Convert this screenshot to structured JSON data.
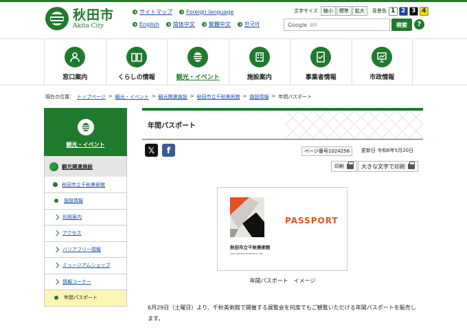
{
  "header": {
    "logo_ja": "秋田市",
    "logo_en": "Akita City",
    "links_row1": [
      "サイトマップ",
      "Foreign language"
    ],
    "links_row2": [
      "English",
      "简体中文",
      "繁體中文",
      "한국어"
    ],
    "text_size_label": "文字サイズ",
    "text_size_buttons": [
      "縮小",
      "標準",
      "拡大"
    ],
    "bg_label": "背景色",
    "bg_buttons": [
      "1",
      "2",
      "3",
      "4"
    ],
    "bg_colors": [
      "#ffffff",
      "#1e3fb0",
      "#000000",
      "#f5d400"
    ],
    "search_brand": "Google",
    "search_ad": "提供",
    "search_button": "検索",
    "help_label": "?"
  },
  "gnav": [
    {
      "label": "窓口案内",
      "icon": "person-icon"
    },
    {
      "label": "くらしの情報",
      "icon": "book-icon"
    },
    {
      "label": "観光・イベント",
      "icon": "lantern-icon",
      "active": true
    },
    {
      "label": "施設案内",
      "icon": "building-icon"
    },
    {
      "label": "事業者情報",
      "icon": "document-check-icon"
    },
    {
      "label": "市政情報",
      "icon": "presentation-icon"
    }
  ],
  "breadcrumb": {
    "prefix": "現在の位置：",
    "items": [
      "トップページ",
      "観光・イベント",
      "観光関連施設",
      "秋田市立千秋美術館",
      "施設情報",
      "年間パスポート"
    ]
  },
  "sidebar": {
    "head": "観光・イベント",
    "level1": "観光関連施設",
    "level2": "秋田市立千秋美術館",
    "items": [
      "施設情報",
      "利用案内",
      "アクセス",
      "バリアフリー情報",
      "ミュージアムショップ",
      "情報コーナー",
      "年間パスポート"
    ]
  },
  "main": {
    "title": "年間パスポート",
    "page_id": "ページ番号1024256",
    "updated": "更新日 令和6年5月20日",
    "print_label": "印刷",
    "print_large_label": "大きな文字で印刷",
    "figure": {
      "passport": "PASSPORT",
      "museum_ja": "秋田市立千秋美術館",
      "museum_en": "AKITA SENSHU MUSEUM OF ART"
    },
    "caption": "年間パスポート　イメージ",
    "body": "6月29日（土曜日）より、千秋美術館で開催する展覧会を何度でもご観覧いただける年間パスポートを販売します。"
  },
  "colors": {
    "brand": "#1f7a2e",
    "link": "#1a4ea8",
    "passport_red": "#e4501e"
  }
}
